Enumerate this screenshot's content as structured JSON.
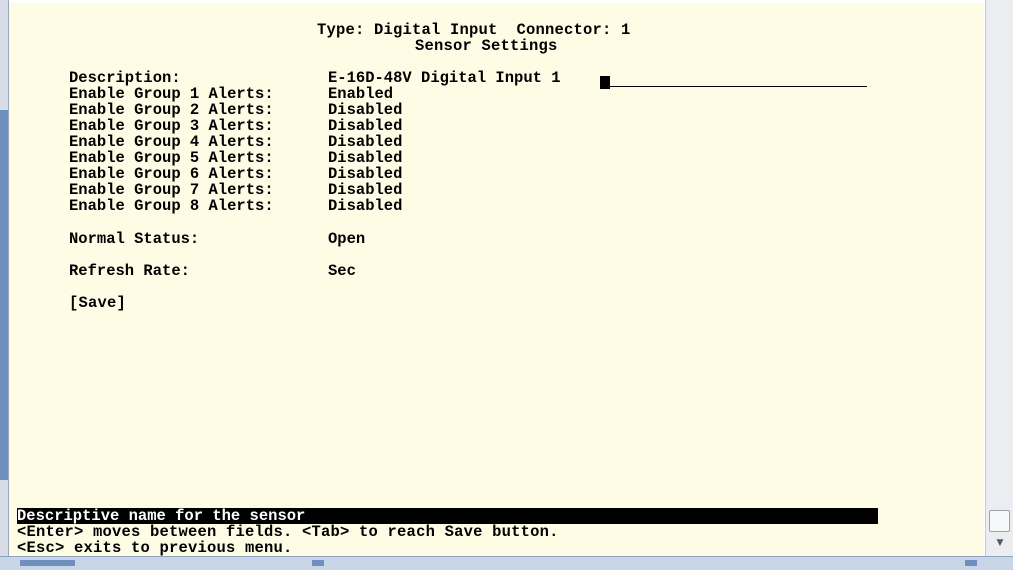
{
  "header": {
    "type_line": "Type: Digital Input  Connector: 1",
    "subtitle": "Sensor Settings"
  },
  "fields": [
    {
      "label": "Description:",
      "value": "E-16D-48V Digital Input 1"
    },
    {
      "label": "Enable Group 1 Alerts:",
      "value": "Enabled"
    },
    {
      "label": "Enable Group 2 Alerts:",
      "value": "Disabled"
    },
    {
      "label": "Enable Group 3 Alerts:",
      "value": "Disabled"
    },
    {
      "label": "Enable Group 4 Alerts:",
      "value": "Disabled"
    },
    {
      "label": "Enable Group 5 Alerts:",
      "value": "Disabled"
    },
    {
      "label": "Enable Group 6 Alerts:",
      "value": "Disabled"
    },
    {
      "label": "Enable Group 7 Alerts:",
      "value": "Disabled"
    },
    {
      "label": "Enable Group 8 Alerts:",
      "value": "Disabled"
    },
    {
      "label": "Normal Status:",
      "value": "Open"
    },
    {
      "label": "Refresh Rate:",
      "value": "Sec"
    }
  ],
  "save_button": "[Save]",
  "help": {
    "status": "Descriptive name for the sensor",
    "line1": "<Enter> moves between fields. <Tab> to reach Save button.",
    "line2": "<Esc> exits to previous menu."
  }
}
